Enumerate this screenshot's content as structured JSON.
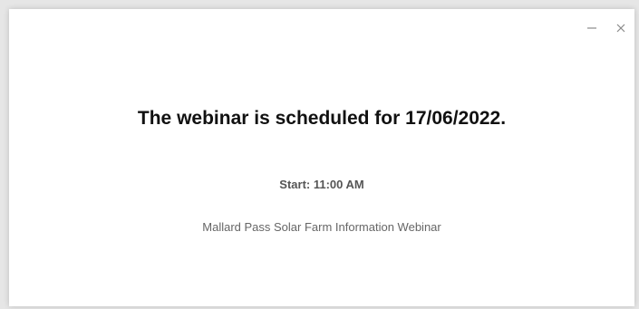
{
  "window": {
    "controls": {
      "minimize_icon": "minimize-icon",
      "close_icon": "close-icon"
    }
  },
  "webinar": {
    "schedule_text": "The webinar is scheduled for 17/06/2022.",
    "start_text": "Start: 11:00 AM",
    "name": "Mallard Pass Solar Farm Information Webinar"
  }
}
